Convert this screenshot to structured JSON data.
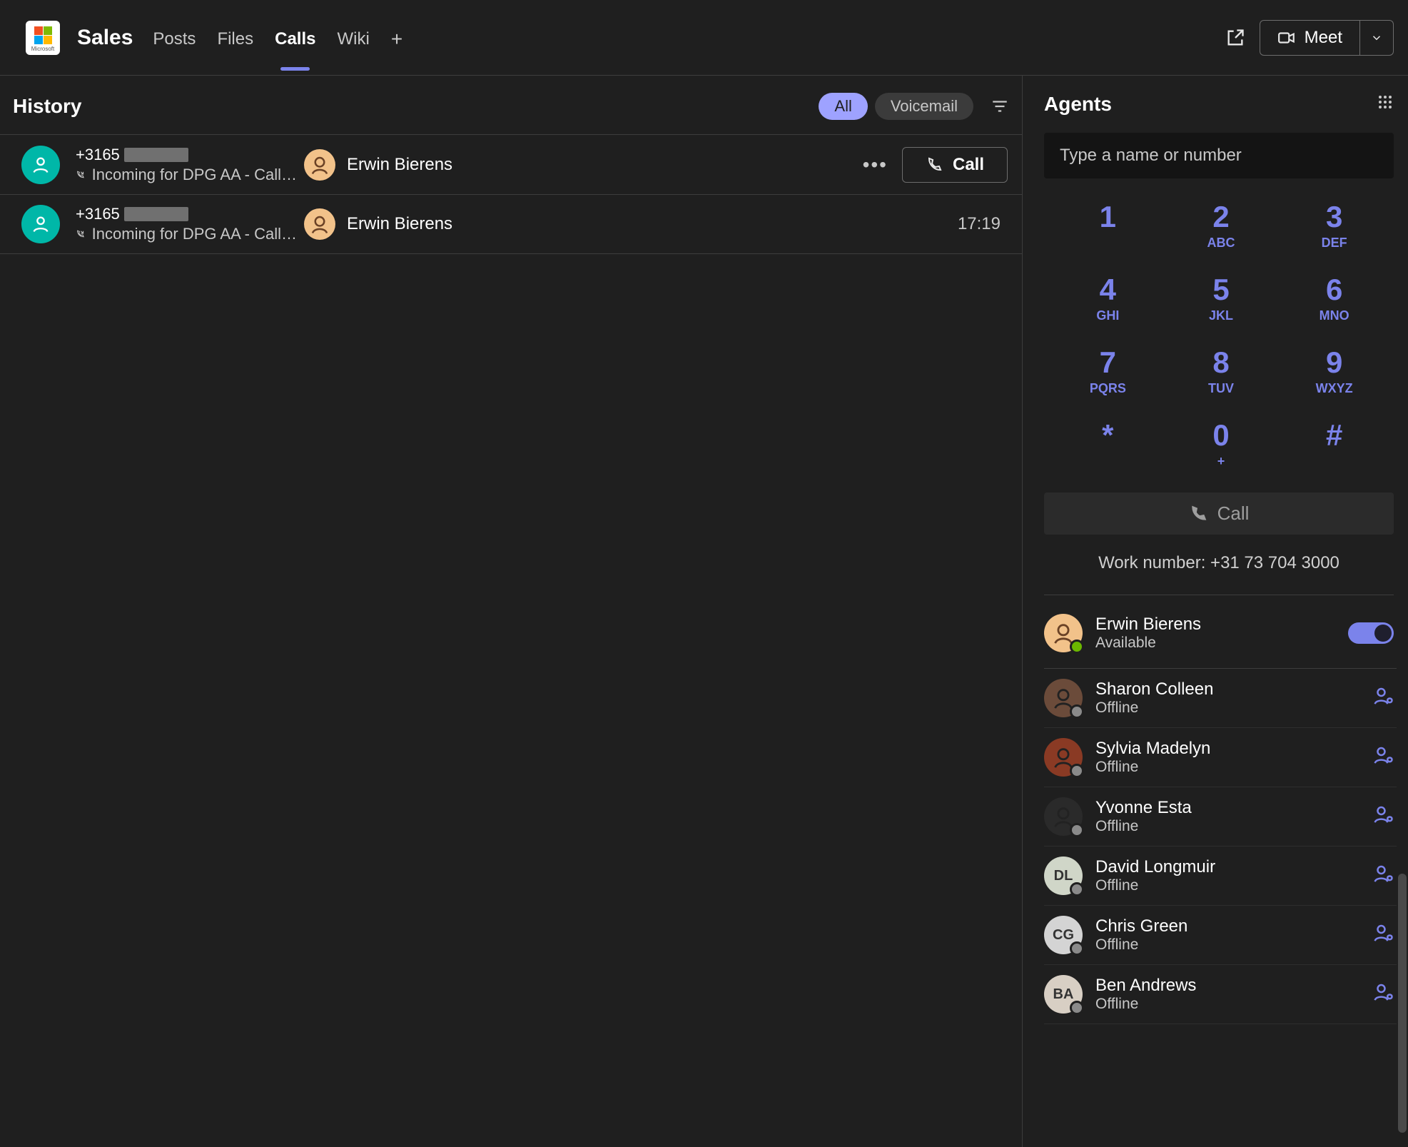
{
  "header": {
    "channel_title": "Sales",
    "tabs": [
      "Posts",
      "Files",
      "Calls",
      "Wiki"
    ],
    "active_tab": "Calls",
    "meet_label": "Meet"
  },
  "history": {
    "title": "History",
    "filters": {
      "all": "All",
      "voicemail": "Voicemail",
      "active": "All"
    },
    "items": [
      {
        "number_prefix": "+3165",
        "subtext": "Incoming for DPG AA - Call…",
        "answered_by": "Erwin Bierens",
        "hovered": true,
        "call_button": "Call"
      },
      {
        "number_prefix": "+3165",
        "subtext": "Incoming for DPG AA - Call…",
        "answered_by": "Erwin Bierens",
        "time": "17:19"
      }
    ]
  },
  "agents": {
    "title": "Agents",
    "search_placeholder": "Type a name or number",
    "dialpad": [
      {
        "digit": "1",
        "letters": ""
      },
      {
        "digit": "2",
        "letters": "ABC"
      },
      {
        "digit": "3",
        "letters": "DEF"
      },
      {
        "digit": "4",
        "letters": "GHI"
      },
      {
        "digit": "5",
        "letters": "JKL"
      },
      {
        "digit": "6",
        "letters": "MNO"
      },
      {
        "digit": "7",
        "letters": "PQRS"
      },
      {
        "digit": "8",
        "letters": "TUV"
      },
      {
        "digit": "9",
        "letters": "WXYZ"
      },
      {
        "digit": "*",
        "letters": ""
      },
      {
        "digit": "0",
        "letters": "+"
      },
      {
        "digit": "#",
        "letters": ""
      }
    ],
    "call_button": "Call",
    "work_number_label": "Work number: +31 73 704 3000",
    "self": {
      "name": "Erwin Bierens",
      "status": "Available",
      "presence": "available",
      "toggle": true
    },
    "list": [
      {
        "name": "Sharon Colleen",
        "status": "Offline",
        "presence": "offline",
        "avatar_bg": "#6b4b3a"
      },
      {
        "name": "Sylvia Madelyn",
        "status": "Offline",
        "presence": "offline",
        "avatar_bg": "#8a3a24"
      },
      {
        "name": "Yvonne Esta",
        "status": "Offline",
        "presence": "offline",
        "avatar_bg": "#2a2a2a"
      },
      {
        "name": "David Longmuir",
        "status": "Offline",
        "presence": "offline",
        "initials": "DL",
        "avatar_bg": "#d0d6c8"
      },
      {
        "name": "Chris Green",
        "status": "Offline",
        "presence": "offline",
        "initials": "CG",
        "avatar_bg": "#d4d4d4"
      },
      {
        "name": "Ben Andrews",
        "status": "Offline",
        "presence": "offline",
        "initials": "BA",
        "avatar_bg": "#d8cfc4"
      }
    ]
  },
  "colors": {
    "accent": "#7b83eb",
    "teal": "#00b7a8"
  }
}
